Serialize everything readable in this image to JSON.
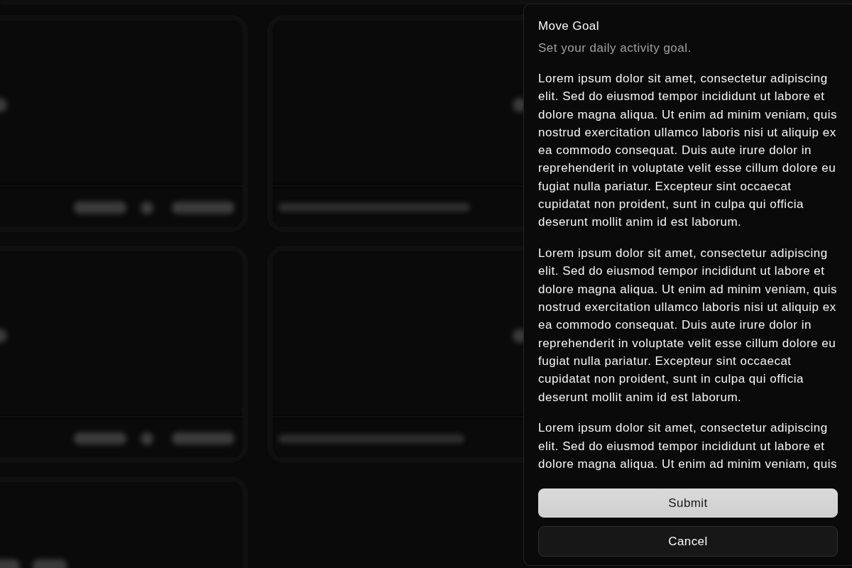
{
  "sheet": {
    "title": "Move Goal",
    "description": "Set your daily activity goal.",
    "paragraphs": [
      "Lorem ipsum dolor sit amet, consectetur adipiscing elit. Sed do eiusmod tempor incididunt ut labore et dolore magna aliqua. Ut enim ad minim veniam, quis nostrud exercitation ullamco laboris nisi ut aliquip ex ea commodo consequat. Duis aute irure dolor in reprehenderit in voluptate velit esse cillum dolore eu fugiat nulla pariatur. Excepteur sint occaecat cupidatat non proident, sunt in culpa qui officia deserunt mollit anim id est laborum.",
      "Lorem ipsum dolor sit amet, consectetur adipiscing elit. Sed do eiusmod tempor incididunt ut labore et dolore magna aliqua. Ut enim ad minim veniam, quis nostrud exercitation ullamco laboris nisi ut aliquip ex ea commodo consequat. Duis aute irure dolor in reprehenderit in voluptate velit esse cillum dolore eu fugiat nulla pariatur. Excepteur sint occaecat cupidatat non proident, sunt in culpa qui officia deserunt mollit anim id est laborum.",
      "Lorem ipsum dolor sit amet, consectetur adipiscing elit. Sed do eiusmod tempor incididunt ut labore et dolore magna aliqua. Ut enim ad minim veniam, quis"
    ],
    "buttons": [
      {
        "label": "Submit",
        "kind": "primary"
      },
      {
        "label": "Cancel",
        "kind": "secondary"
      }
    ]
  }
}
